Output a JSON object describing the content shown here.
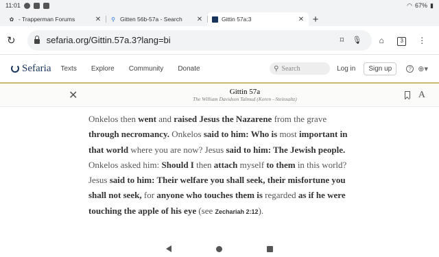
{
  "status_bar": {
    "time": "11:01",
    "battery": "67%"
  },
  "tabs": [
    {
      "title": "- Trapperman Forums",
      "close": "✕"
    },
    {
      "title": "Gitten 56b-57a - Search",
      "close": "✕"
    },
    {
      "title": "Gittin 57a:3",
      "close": "✕"
    }
  ],
  "new_tab_label": "+",
  "address_bar": {
    "url": "sefaria.org/Gittin.57a.3?lang=bi",
    "tab_count": "3"
  },
  "site": {
    "logo_text": "Sefaria",
    "nav": [
      "Texts",
      "Explore",
      "Community",
      "Donate"
    ],
    "search_placeholder": "Search",
    "login": "Log in",
    "signup": "Sign up"
  },
  "text_header": {
    "ref": "Gittin 57a",
    "version": "The William Davidson Talmud (Koren - Steinsaltz)",
    "font_label": "A"
  },
  "passage": {
    "segments": [
      {
        "t": "Onkelos then ",
        "b": false
      },
      {
        "t": "went",
        "b": true
      },
      {
        "t": " and ",
        "b": false
      },
      {
        "t": "raised Jesus the Nazarene",
        "b": true
      },
      {
        "t": " from the grave ",
        "b": false
      },
      {
        "t": "through necromancy.",
        "b": true
      },
      {
        "t": " Onkelos ",
        "b": false
      },
      {
        "t": "said to him: Who is",
        "b": true
      },
      {
        "t": " most ",
        "b": false
      },
      {
        "t": "important in that world",
        "b": true
      },
      {
        "t": " where you are now? Jesus ",
        "b": false
      },
      {
        "t": "said to him: The Jewish people.",
        "b": true
      },
      {
        "t": " Onkelos asked him: ",
        "b": false
      },
      {
        "t": "Should I",
        "b": true
      },
      {
        "t": " then ",
        "b": false
      },
      {
        "t": "attach",
        "b": true
      },
      {
        "t": " myself ",
        "b": false
      },
      {
        "t": "to them",
        "b": true
      },
      {
        "t": " in this world? Jesus ",
        "b": false
      },
      {
        "t": "said to him: Their welfare you shall seek, their misfortune you shall not seek,",
        "b": true
      },
      {
        "t": " for ",
        "b": false
      },
      {
        "t": "anyone who touches them is",
        "b": true
      },
      {
        "t": " regarded ",
        "b": false
      },
      {
        "t": "as if he were touching the apple of his eye",
        "b": true
      },
      {
        "t": " (see ",
        "b": false
      },
      {
        "t": "Zechariah 2:12",
        "b": "cite"
      },
      {
        "t": ").",
        "b": false
      }
    ]
  }
}
